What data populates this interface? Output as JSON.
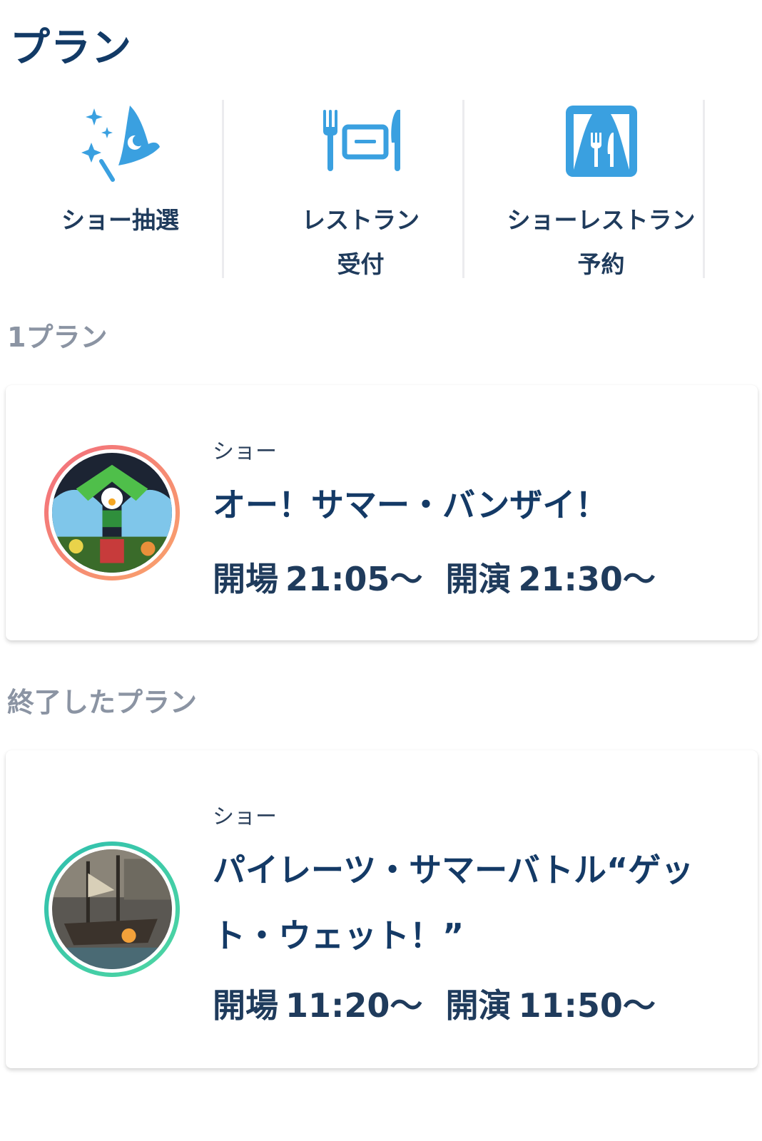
{
  "page": {
    "title": "プラン"
  },
  "menu": [
    {
      "label_line1": "ショー抽選",
      "label_line2": "",
      "icon": "wizard-hat-icon"
    },
    {
      "label_line1": "レストラン",
      "label_line2": "受付",
      "icon": "restaurant-icon"
    },
    {
      "label_line1": "ショーレストラン",
      "label_line2": "予約",
      "icon": "show-restaurant-icon"
    }
  ],
  "sections": {
    "active": {
      "label": "1プラン"
    },
    "finished": {
      "label": "終了したプラン"
    }
  },
  "plans": [
    {
      "category": "ショー",
      "title": "オー！サマー・バンザイ！",
      "open_label": "開場",
      "open_time": "21:05〜",
      "start_label": "開演",
      "start_time": "21:30〜",
      "ring_color": "#f5876a"
    },
    {
      "category": "ショー",
      "title": "パイレーツ・サマーバトル“ゲット・ウェット！”",
      "open_label": "開場",
      "open_time": "11:20〜",
      "start_label": "開演",
      "start_time": "11:50〜",
      "ring_color": "#3cc9a8"
    }
  ],
  "colors": {
    "accent": "#3aa0e0",
    "title": "#123a66",
    "muted": "#8b94a3"
  }
}
